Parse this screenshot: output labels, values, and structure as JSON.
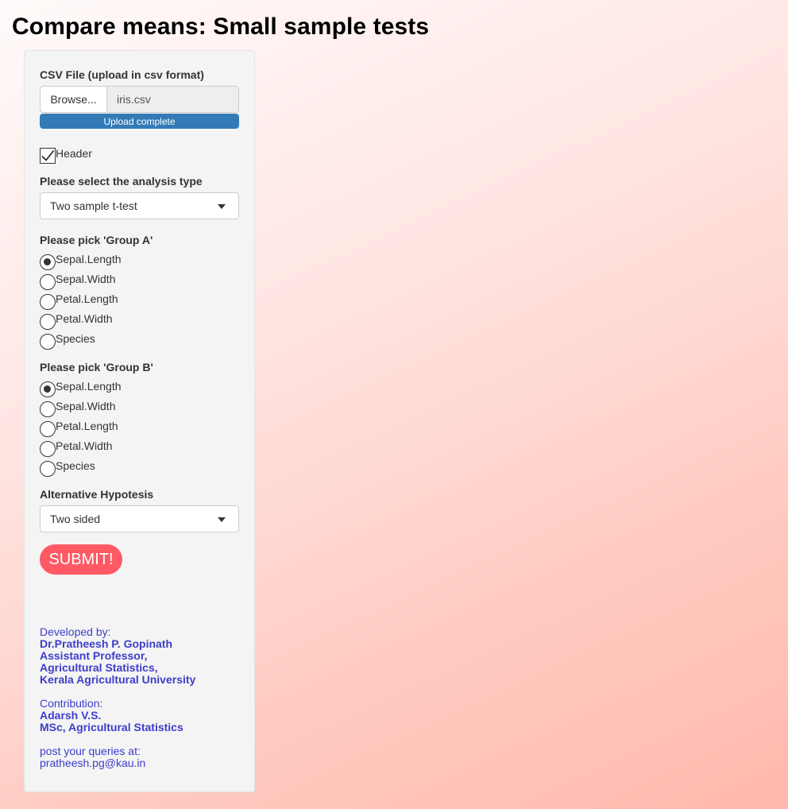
{
  "page": {
    "title": "Compare means: Small sample tests"
  },
  "file_input": {
    "label": "CSV File (upload in csv format)",
    "browse_label": "Browse...",
    "file_name": "iris.csv",
    "progress_text": "Upload complete",
    "progress_fraction": 1.0
  },
  "header_checkbox": {
    "label": "Header",
    "checked": true
  },
  "analysis_type": {
    "label": "Please select the analysis type",
    "selected": "Two sample t-test"
  },
  "group_a": {
    "label": "Please pick 'Group A'",
    "options": [
      "Sepal.Length",
      "Sepal.Width",
      "Petal.Length",
      "Petal.Width",
      "Species"
    ],
    "selected": "Sepal.Length"
  },
  "group_b": {
    "label": "Please pick 'Group B'",
    "options": [
      "Sepal.Length",
      "Sepal.Width",
      "Petal.Length",
      "Petal.Width",
      "Species"
    ],
    "selected": "Sepal.Length"
  },
  "alternative": {
    "label": "Alternative Hypotesis",
    "selected": "Two sided"
  },
  "submit": {
    "label": "SUBMIT!"
  },
  "credits": {
    "developed_label": "Developed by:",
    "developer_name": "Dr.Pratheesh P. Gopinath",
    "developer_title": "Assistant Professor,",
    "developer_dept": "Agricultural Statistics,",
    "developer_univ": "Kerala Agricultural University",
    "contribution_label": "Contribution:",
    "contributor_name": "Adarsh V.S.",
    "contributor_degree": "MSc, Agricultural Statistics",
    "queries_label": "post your queries at:",
    "email": "pratheesh.pg@kau.in"
  },
  "colors": {
    "submit_button": "#ff5964",
    "progress_bar": "#337ab7",
    "credits_text": "#3d3dcb",
    "sidebar_bg": "#f4f4f4"
  }
}
